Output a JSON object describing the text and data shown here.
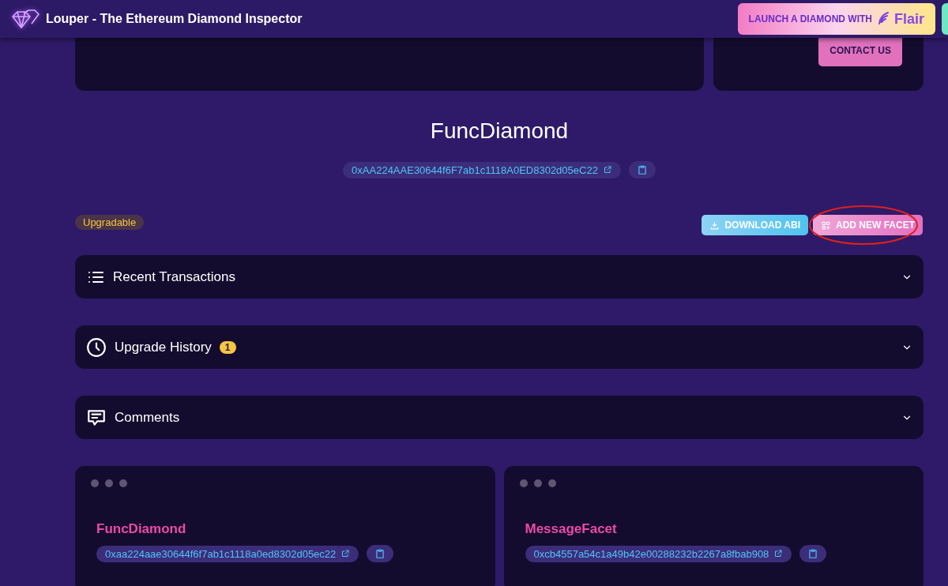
{
  "header": {
    "title": "Louper - The Ethereum Diamond Inspector",
    "promo_button": {
      "label": "LAUNCH A DIAMOND WITH",
      "brand": "Flair"
    }
  },
  "contact_button": {
    "label": "CONTACT US"
  },
  "diamond": {
    "name": "FuncDiamond",
    "address": "0xAA224AAE30644f6F7ab1c1118A0ED8302d05eC22",
    "badge": "Upgradable"
  },
  "actions": [
    {
      "kind": "download",
      "label": "DOWNLOAD ABI",
      "highlighted": false
    },
    {
      "kind": "add",
      "label": "ADD NEW FACET",
      "highlighted": true
    }
  ],
  "sections": [
    {
      "kind": "list",
      "title": "Recent Transactions",
      "expanded": false
    },
    {
      "kind": "clock",
      "title": "Upgrade History",
      "count": "1",
      "expanded": false
    },
    {
      "kind": "comment",
      "title": "Comments",
      "expanded": false
    }
  ],
  "facets": [
    {
      "name": "FuncDiamond",
      "address": "0xaa224aae30644f6f7ab1c1118a0ed8302d05ec22"
    },
    {
      "name": "MessageFacet",
      "address": "0xcb4557a54c1a49b42e00288232b2267a8fbab908"
    }
  ]
}
